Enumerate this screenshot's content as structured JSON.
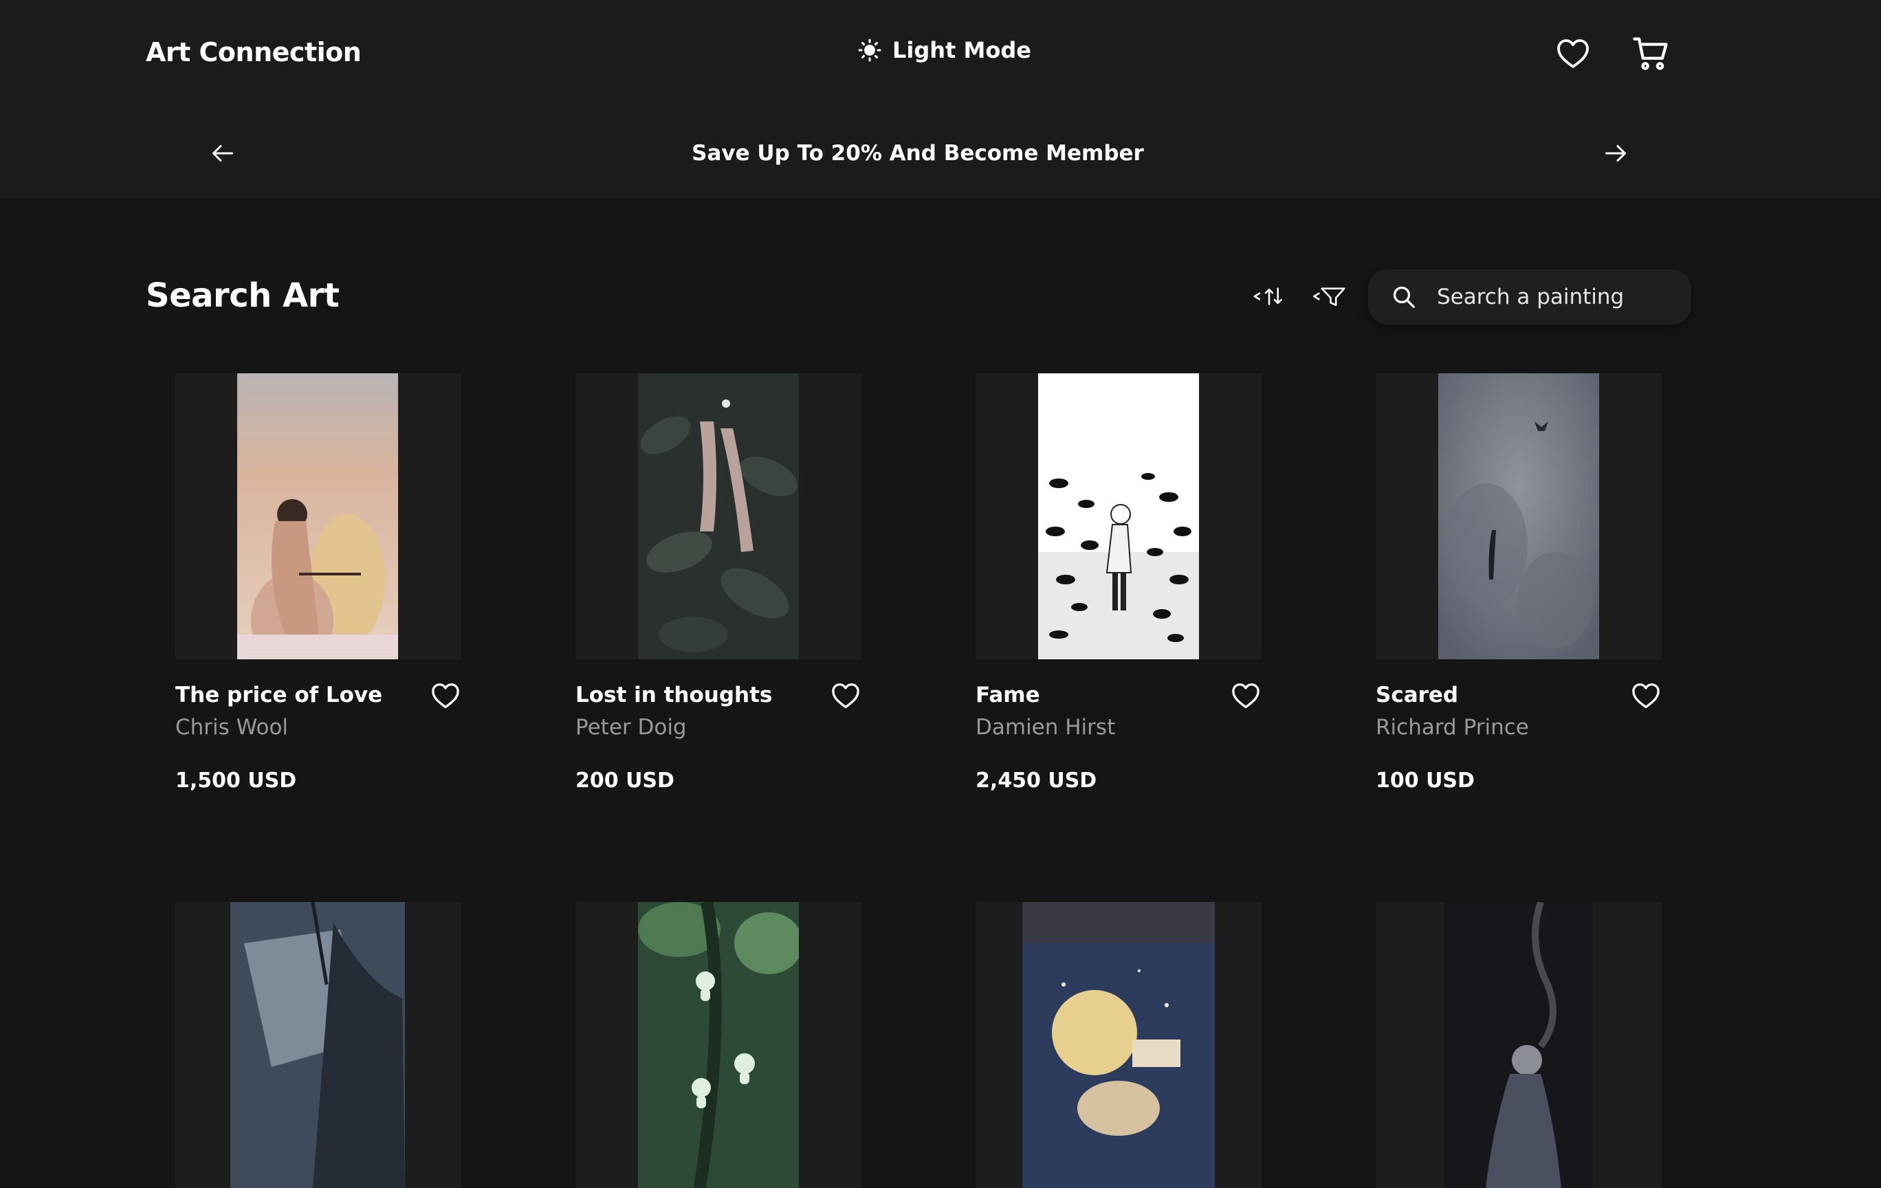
{
  "header": {
    "brand": "Art Connection",
    "mode_label": "Light Mode",
    "icons": {
      "mode": "sun-icon",
      "wishlist": "heart-icon",
      "cart": "cart-icon"
    }
  },
  "promo": {
    "text": "Save Up To 20% And Become Member",
    "icons": {
      "prev": "arrow-left-icon",
      "next": "arrow-right-icon"
    }
  },
  "search_section": {
    "title": "Search Art",
    "icons": {
      "sort": "sort-icon",
      "filter": "filter-icon",
      "search": "search-icon"
    },
    "search": {
      "placeholder": "Search a painting",
      "value": ""
    }
  },
  "products": [
    {
      "title": "The price of Love",
      "artist": "Chris Wool",
      "price": "1,500 USD"
    },
    {
      "title": "Lost in thoughts",
      "artist": "Peter Doig",
      "price": "200 USD"
    },
    {
      "title": "Fame",
      "artist": "Damien Hirst",
      "price": "2,450 USD"
    },
    {
      "title": "Scared",
      "artist": "Richard Prince",
      "price": "100 USD"
    },
    {
      "title": "",
      "artist": "",
      "price": ""
    },
    {
      "title": "",
      "artist": "",
      "price": ""
    },
    {
      "title": "",
      "artist": "",
      "price": ""
    },
    {
      "title": "",
      "artist": "",
      "price": ""
    }
  ],
  "colors": {
    "background": "#151515",
    "header_bg": "#1b1b1c",
    "card_bg": "#1d1d1e",
    "text_primary": "#ffffff",
    "text_secondary": "#9a9a9a"
  }
}
